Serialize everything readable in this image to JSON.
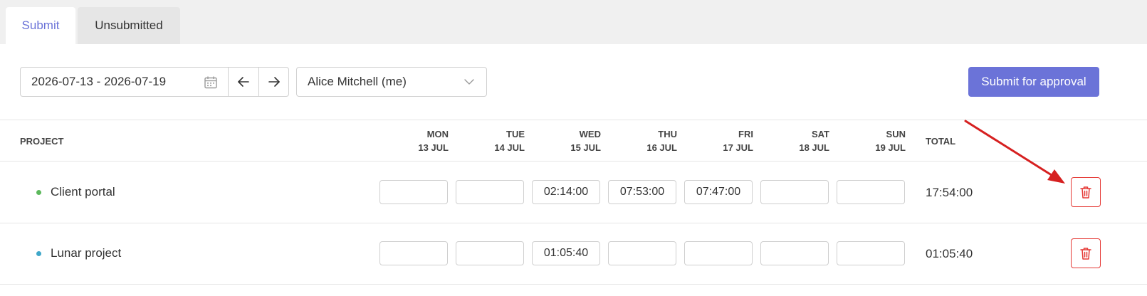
{
  "tabs": [
    {
      "label": "Submit",
      "active": true
    },
    {
      "label": "Unsubmitted",
      "active": false
    }
  ],
  "toolbar": {
    "date_range": "2026-07-13 - 2026-07-19",
    "user": "Alice Mitchell (me)",
    "submit_label": "Submit for approval"
  },
  "table": {
    "project_header": "PROJECT",
    "total_header": "TOTAL",
    "days": [
      {
        "dow": "MON",
        "date": "13 JUL"
      },
      {
        "dow": "TUE",
        "date": "14 JUL"
      },
      {
        "dow": "WED",
        "date": "15 JUL"
      },
      {
        "dow": "THU",
        "date": "16 JUL"
      },
      {
        "dow": "FRI",
        "date": "17 JUL"
      },
      {
        "dow": "SAT",
        "date": "18 JUL"
      },
      {
        "dow": "SUN",
        "date": "19 JUL"
      }
    ],
    "rows": [
      {
        "name": "Client portal",
        "color": "#5cb85c",
        "cells": [
          "",
          "",
          "02:14:00",
          "07:53:00",
          "07:47:00",
          "",
          ""
        ],
        "total": "17:54:00"
      },
      {
        "name": "Lunar project",
        "color": "#3fa7c9",
        "cells": [
          "",
          "",
          "01:05:40",
          "",
          "",
          "",
          ""
        ],
        "total": "01:05:40"
      }
    ]
  },
  "colors": {
    "accent": "#6b73d8",
    "danger": "#e53935",
    "annotation_arrow": "#d62020"
  },
  "icons": [
    "calendar-icon",
    "arrow-left-icon",
    "arrow-right-icon",
    "chevron-down-icon",
    "trash-icon"
  ]
}
